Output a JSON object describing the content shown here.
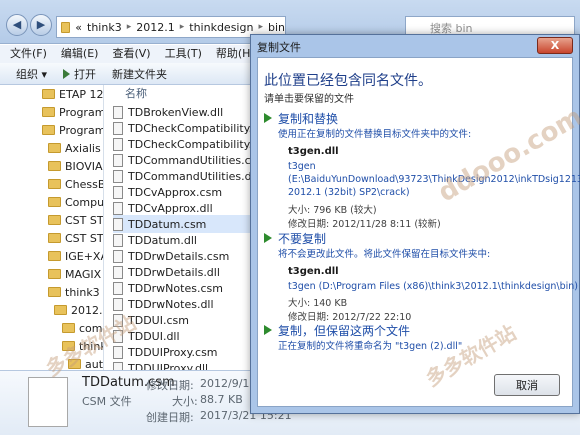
{
  "explorer": {
    "breadcrumb": [
      "«",
      "think3",
      "2012.1",
      "thinkdesign",
      "bin"
    ],
    "search_placeholder": "搜索 bin",
    "menu": [
      "文件(F)",
      "编辑(E)",
      "查看(V)",
      "工具(T)",
      "帮助(H)"
    ],
    "toolbar": {
      "organize": "组织 ▾",
      "open": "打开",
      "new_folder": "新建文件夹"
    },
    "nav_items": [
      "ETAP 1260",
      "Program File",
      "Program File",
      "Axialis",
      "BIOVIA",
      "ChessBase",
      "Computer",
      "CST STUD",
      "CST STUD",
      "IGE+XAO",
      "MAGIX",
      "think3",
      "2012.1",
      "common",
      "thinkdesign",
      "autol",
      "bin",
      "NE"
    ],
    "column_header": "名称",
    "files": [
      "TDBrokenView.dll",
      "TDCheckCompatibility.csm",
      "TDCheckCompatibility.dll",
      "TDCommandUtilities.csm",
      "TDCommandUtilities.dll",
      "TDCvApprox.csm",
      "TDCvApprox.dll",
      "TDDatum.csm",
      "TDDatum.dll",
      "TDDrwDetails.csm",
      "TDDrwDetails.dll",
      "TDDrwNotes.csm",
      "TDDrwNotes.dll",
      "TDDUI.csm",
      "TDDUI.dll",
      "TDDUIProxy.csm",
      "TDDUIProxy.dll",
      "TDesign.csm"
    ],
    "details": {
      "name": "TDDatum.csm",
      "type": "CSM 文件",
      "modified_label": "修改日期:",
      "modified_value": "2012/9/18 6:20",
      "size_label": "大小:",
      "size_value": "88.7 KB",
      "created_label": "创建日期:",
      "created_value": "2017/3/21 15:21"
    }
  },
  "dialog": {
    "title": "复制文件",
    "close_label": "X",
    "heading": "此位置已经包含同名文件。",
    "subheading": "请单击要保留的文件",
    "replace": {
      "title": "复制和替换",
      "desc": "使用正在复制的文件替换目标文件夹中的文件:",
      "filename": "t3gen.dll",
      "name_line": "t3gen",
      "path_line1": "(E:\\BaiduYunDownload\\93723\\ThinkDesign2012\\inkTDsig12132bS",
      "path_line2": "2012.1 (32bit) SP2\\crack)",
      "size": "大小: 796 KB (较大)",
      "date": "修改日期: 2012/11/28 8:11 (较新)"
    },
    "skip": {
      "title": "不要复制",
      "desc": "将不会更改此文件。将此文件保留在目标文件夹中:",
      "filename": "t3gen.dll",
      "path_line": "t3gen (D:\\Program Files (x86)\\think3\\2012.1\\thinkdesign\\bin)",
      "size": "大小: 140 KB",
      "date": "修改日期: 2012/7/22 22:10"
    },
    "keep_both": {
      "title": "复制，但保留这两个文件",
      "desc": "正在复制的文件将重命名为 \"t3gen (2).dll\""
    },
    "cancel_label": "取消"
  }
}
